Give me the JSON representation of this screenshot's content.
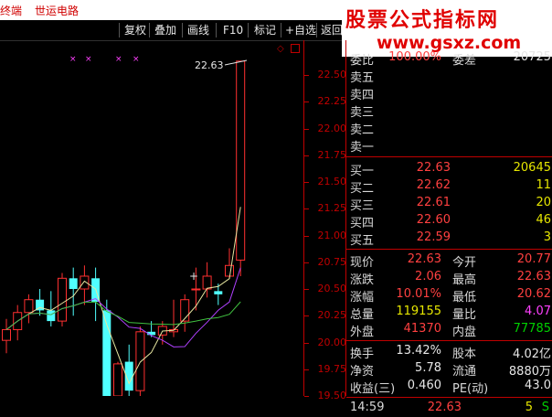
{
  "titlebar": {
    "app_title": "终端",
    "stock_name": "世运电路"
  },
  "toolbar": {
    "buttons": [
      "复权",
      "叠加",
      "画线",
      "F10",
      "标记",
      "+自选",
      "返回"
    ]
  },
  "watermark": {
    "line1": "股票公式指标网",
    "line2": "www.gsxz.com"
  },
  "chart": {
    "max_label": "22.63",
    "y_ticks": [
      "22.50",
      "22.25",
      "22.00",
      "21.75",
      "21.50",
      "21.25",
      "21.00",
      "20.75",
      "20.50",
      "20.25",
      "20.00",
      "19.75",
      "19.50"
    ],
    "ylim": [
      19.5,
      22.62
    ],
    "candles": [
      {
        "o": 20.02,
        "h": 20.22,
        "l": 19.9,
        "c": 20.12
      },
      {
        "o": 20.12,
        "h": 20.35,
        "l": 20.02,
        "c": 20.28
      },
      {
        "o": 20.28,
        "h": 20.45,
        "l": 20.18,
        "c": 20.4
      },
      {
        "o": 20.4,
        "h": 20.5,
        "l": 20.25,
        "c": 20.3
      },
      {
        "o": 20.3,
        "h": 20.48,
        "l": 20.15,
        "c": 20.2
      },
      {
        "o": 20.2,
        "h": 20.65,
        "l": 20.15,
        "c": 20.6
      },
      {
        "o": 20.6,
        "h": 20.7,
        "l": 20.25,
        "c": 20.5
      },
      {
        "o": 20.5,
        "h": 20.72,
        "l": 20.35,
        "c": 20.62
      },
      {
        "o": 20.6,
        "h": 20.7,
        "l": 20.2,
        "c": 20.38
      },
      {
        "o": 20.3,
        "h": 20.4,
        "l": 19.5,
        "c": 19.5
      },
      {
        "o": 19.5,
        "h": 19.82,
        "l": 19.5,
        "c": 19.8
      },
      {
        "o": 19.82,
        "h": 19.98,
        "l": 19.5,
        "c": 19.55
      },
      {
        "o": 19.55,
        "h": 20.15,
        "l": 19.5,
        "c": 20.1
      },
      {
        "o": 20.1,
        "h": 20.2,
        "l": 20.05,
        "c": 20.07
      },
      {
        "o": 20.07,
        "h": 20.2,
        "l": 19.98,
        "c": 20.15
      },
      {
        "o": 20.1,
        "h": 20.4,
        "l": 20.05,
        "c": 20.12
      },
      {
        "o": 20.2,
        "h": 20.45,
        "l": 20.1,
        "c": 20.4
      },
      {
        "o": 20.5,
        "h": 20.7,
        "l": 20.3,
        "c": 20.5
      },
      {
        "o": 20.5,
        "h": 20.75,
        "l": 20.42,
        "c": 20.62
      },
      {
        "o": 20.48,
        "h": 20.55,
        "l": 20.35,
        "c": 20.45
      },
      {
        "o": 20.62,
        "h": 20.88,
        "l": 20.6,
        "c": 20.72
      },
      {
        "o": 20.77,
        "h": 22.63,
        "l": 20.62,
        "c": 22.63
      }
    ]
  },
  "panel": {
    "top_row": {
      "label": "委比",
      "value": "100.00%",
      "label2": "委差",
      "value2": "20725"
    },
    "sell": [
      {
        "label": "卖五",
        "price": "",
        "vol": ""
      },
      {
        "label": "卖四",
        "price": "",
        "vol": ""
      },
      {
        "label": "卖三",
        "price": "",
        "vol": ""
      },
      {
        "label": "卖二",
        "price": "",
        "vol": ""
      },
      {
        "label": "卖一",
        "price": "",
        "vol": ""
      }
    ],
    "buy": [
      {
        "label": "买一",
        "price": "22.63",
        "vol": "20645"
      },
      {
        "label": "买二",
        "price": "22.62",
        "vol": "11"
      },
      {
        "label": "买三",
        "price": "22.61",
        "vol": "20"
      },
      {
        "label": "买四",
        "price": "22.60",
        "vol": "46"
      },
      {
        "label": "买五",
        "price": "22.59",
        "vol": "3"
      }
    ],
    "stats": [
      {
        "l": "现价",
        "v": "22.63",
        "l2": "今开",
        "v2": "20.77"
      },
      {
        "l": "涨跌",
        "v": "2.06",
        "l2": "最高",
        "v2": "22.63"
      },
      {
        "l": "涨幅",
        "v": "10.01%",
        "l2": "最低",
        "v2": "20.62"
      },
      {
        "l": "总量",
        "v": "119155",
        "l2": "量比",
        "v2": "4.07"
      },
      {
        "l": "外盘",
        "v": "41370",
        "l2": "内盘",
        "v2": "77785"
      }
    ],
    "fund": [
      {
        "l": "换手",
        "v": "13.42%",
        "l2": "股本",
        "v2": "4.02亿"
      },
      {
        "l": "净资",
        "v": "5.78",
        "l2": "流通",
        "v2": "8880万"
      },
      {
        "l": "收益(三)",
        "v": "0.460",
        "l2": "PE(动)",
        "v2": "43.0"
      }
    ],
    "tick": {
      "time": "14:59",
      "price": "22.63",
      "vol": "5",
      "dir": "S"
    }
  },
  "colors": {
    "up": "#ff3030",
    "down": "#50ffff",
    "axis": "#c00000",
    "ma5": "#e6e6a0",
    "ma10": "#b040ff",
    "ma20": "#40c040"
  }
}
